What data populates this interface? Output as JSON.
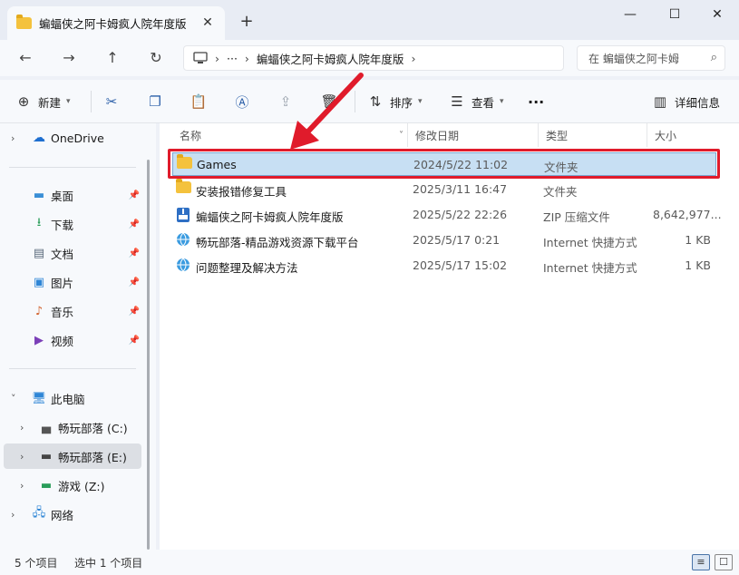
{
  "window": {
    "tab_title": "蝙蝠侠之阿卡姆疯人院年度版",
    "tab_close": "✕",
    "new_tab": "+",
    "minimize": "—",
    "maximize": "☐",
    "close": "✕"
  },
  "nav": {
    "back": "←",
    "forward": "→",
    "up": "↑",
    "refresh": "↻",
    "address_more": "···",
    "address_path": "蝙蝠侠之阿卡姆疯人院年度版",
    "search_placeholder": "在 蝙蝠侠之阿卡姆"
  },
  "toolbar": {
    "new_label": "新建",
    "sort_label": "排序",
    "view_label": "查看",
    "more": "···",
    "details_label": "详细信息"
  },
  "sidebar": {
    "items": [
      {
        "label": "OneDrive",
        "icon": "cloud-icon"
      },
      {
        "label": "桌面",
        "icon": "desktop-icon"
      },
      {
        "label": "下载",
        "icon": "download-icon"
      },
      {
        "label": "文档",
        "icon": "document-icon"
      },
      {
        "label": "图片",
        "icon": "pictures-icon"
      },
      {
        "label": "音乐",
        "icon": "music-icon"
      },
      {
        "label": "视频",
        "icon": "video-icon"
      },
      {
        "label": "此电脑",
        "icon": "computer-icon"
      },
      {
        "label": "畅玩部落 (C:)",
        "icon": "drive-c-icon"
      },
      {
        "label": "畅玩部落 (E:)",
        "icon": "drive-e-icon"
      },
      {
        "label": "游戏 (Z:)",
        "icon": "drive-z-icon"
      },
      {
        "label": "网络",
        "icon": "network-icon"
      }
    ]
  },
  "columns": {
    "name": "名称",
    "date": "修改日期",
    "type": "类型",
    "size": "大小"
  },
  "files": [
    {
      "name": "Games",
      "date": "2024/5/22 11:02",
      "type": "文件夹",
      "size": ""
    },
    {
      "name": "安装报错修复工具",
      "date": "2025/3/11 16:47",
      "type": "文件夹",
      "size": ""
    },
    {
      "name": "蝙蝠侠之阿卡姆疯人院年度版",
      "date": "2025/5/22 22:26",
      "type": "ZIP 压缩文件",
      "size": "8,642,977..."
    },
    {
      "name": "畅玩部落-精品游戏资源下载平台",
      "date": "2025/5/17 0:21",
      "type": "Internet 快捷方式",
      "size": "1 KB"
    },
    {
      "name": "问题整理及解决方法",
      "date": "2025/5/17 15:02",
      "type": "Internet 快捷方式",
      "size": "1 KB"
    }
  ],
  "status": {
    "count": "5 个项目",
    "selected": "选中 1 个项目"
  },
  "colors": {
    "highlight": "#e01b2b",
    "selection": "#c7dff3"
  }
}
